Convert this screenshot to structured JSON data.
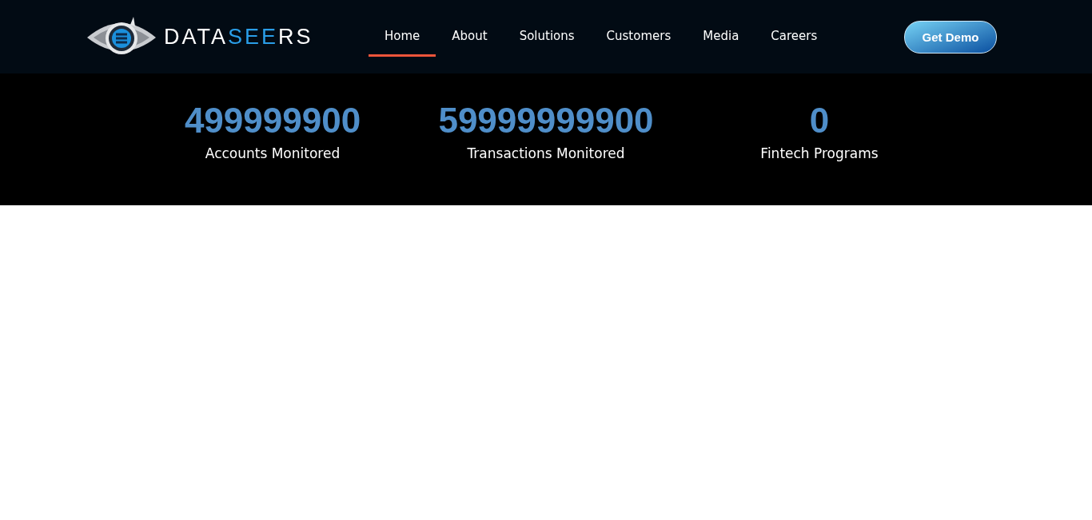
{
  "header": {
    "logo": {
      "parts": [
        {
          "text": "DATA",
          "accent": false
        },
        {
          "text": "SEE",
          "accent": true
        },
        {
          "text": "RS",
          "accent": false
        }
      ]
    },
    "nav": [
      {
        "label": "Home",
        "selected": true
      },
      {
        "label": "About",
        "selected": false
      },
      {
        "label": "Solutions",
        "selected": false
      },
      {
        "label": "Customers",
        "selected": false
      },
      {
        "label": "Media",
        "selected": false
      },
      {
        "label": "Careers",
        "selected": false
      }
    ],
    "cta": "Get Demo"
  },
  "stats": [
    {
      "value": "499999900",
      "label": "Accounts Monitored"
    },
    {
      "value": "59999999900",
      "label": "Transactions Monitored"
    },
    {
      "value": "0",
      "label": "Fintech Programs"
    }
  ]
}
